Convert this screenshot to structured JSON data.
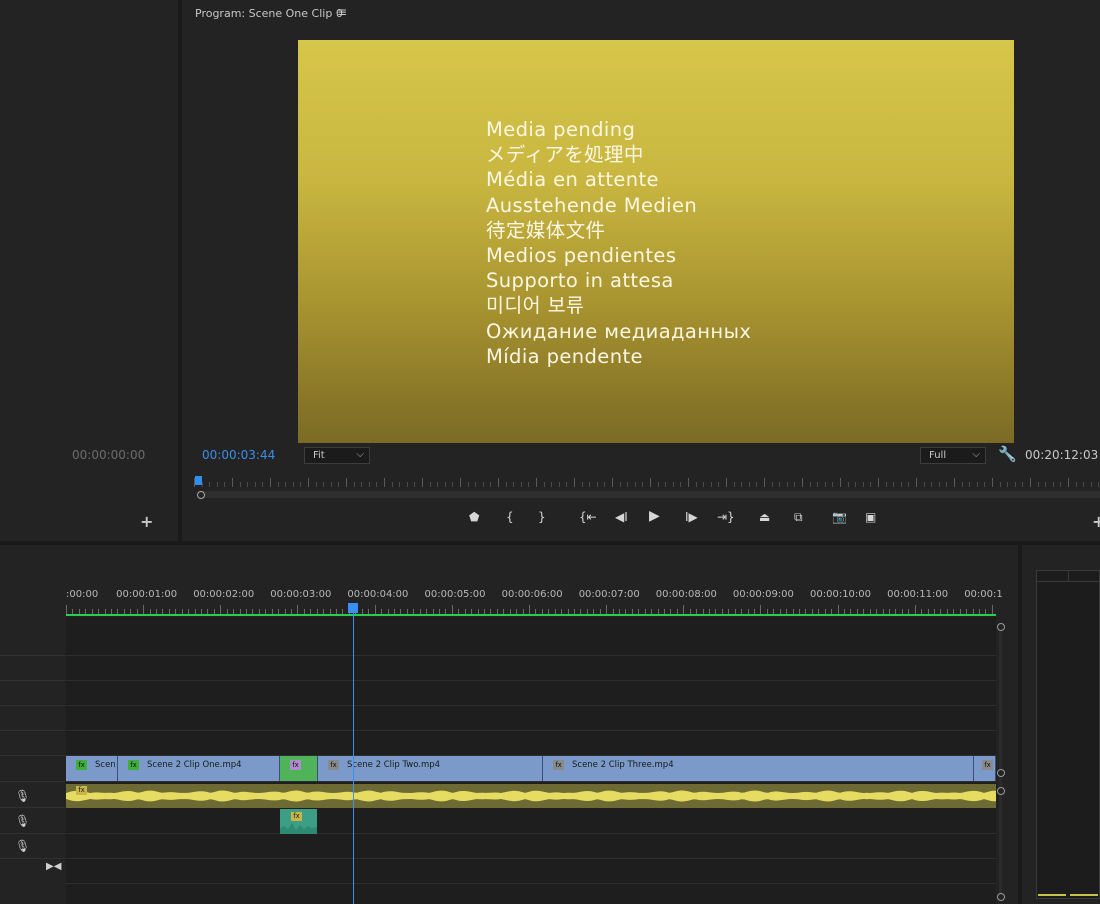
{
  "source": {
    "timecode": "00:00:00:00",
    "add_icon": "+"
  },
  "program": {
    "title": "Program: Scene One Clip 0",
    "menu_icon": "≡",
    "pending_messages": [
      "Media pending",
      "メディアを処理中",
      "Média en attente",
      "Ausstehende Medien",
      "待定媒体文件",
      "Medios pendientes",
      "Supporto in attesa",
      "미디어 보류",
      "Ожидание медиаданных",
      "Mídia pendente"
    ],
    "playhead_timecode": "00:00:03:44",
    "fit": "Fit",
    "resolution": "Full",
    "duration": "00:20:12:03",
    "add_icon": "+",
    "transport_icons": [
      "add-marker-icon",
      "mark-in-icon",
      "mark-out-icon",
      "go-to-in-icon",
      "step-back-icon",
      "play-icon",
      "step-forward-icon",
      "go-to-out-icon",
      "lift-icon",
      "extract-icon",
      "export-frame-icon",
      "comparison-view-icon"
    ]
  },
  "timeline": {
    "ruler_labels": [
      ":00:00",
      "00:00:01:00",
      "00:00:02:00",
      "00:00:03:00",
      "00:00:04:00",
      "00:00:05:00",
      "00:00:06:00",
      "00:00:07:00",
      "00:00:08:00",
      "00:00:09:00",
      "00:00:10:00",
      "00:00:11:00",
      "00:00:1"
    ],
    "clips": [
      {
        "label": "Scen",
        "fx": "fx"
      },
      {
        "label": "Scene 2 Clip One.mp4",
        "fx": "fx"
      },
      {
        "label": "",
        "fx": "fx"
      },
      {
        "label": "Scene 2 Clip Two.mp4",
        "fx": "fx"
      },
      {
        "label": "Scene 2 Clip Three.mp4",
        "fx": "fx"
      },
      {
        "label": "",
        "fx": "fx"
      }
    ],
    "audio_fx": "fx",
    "audio2_fx": "fx",
    "work_area_color": "#26d04a",
    "playhead_color": "#3b8ff0"
  },
  "colors": {
    "accent_blue": "#3a8eea",
    "video_clip": "#7b9ac9",
    "audio_clip": "#6e6a33"
  }
}
